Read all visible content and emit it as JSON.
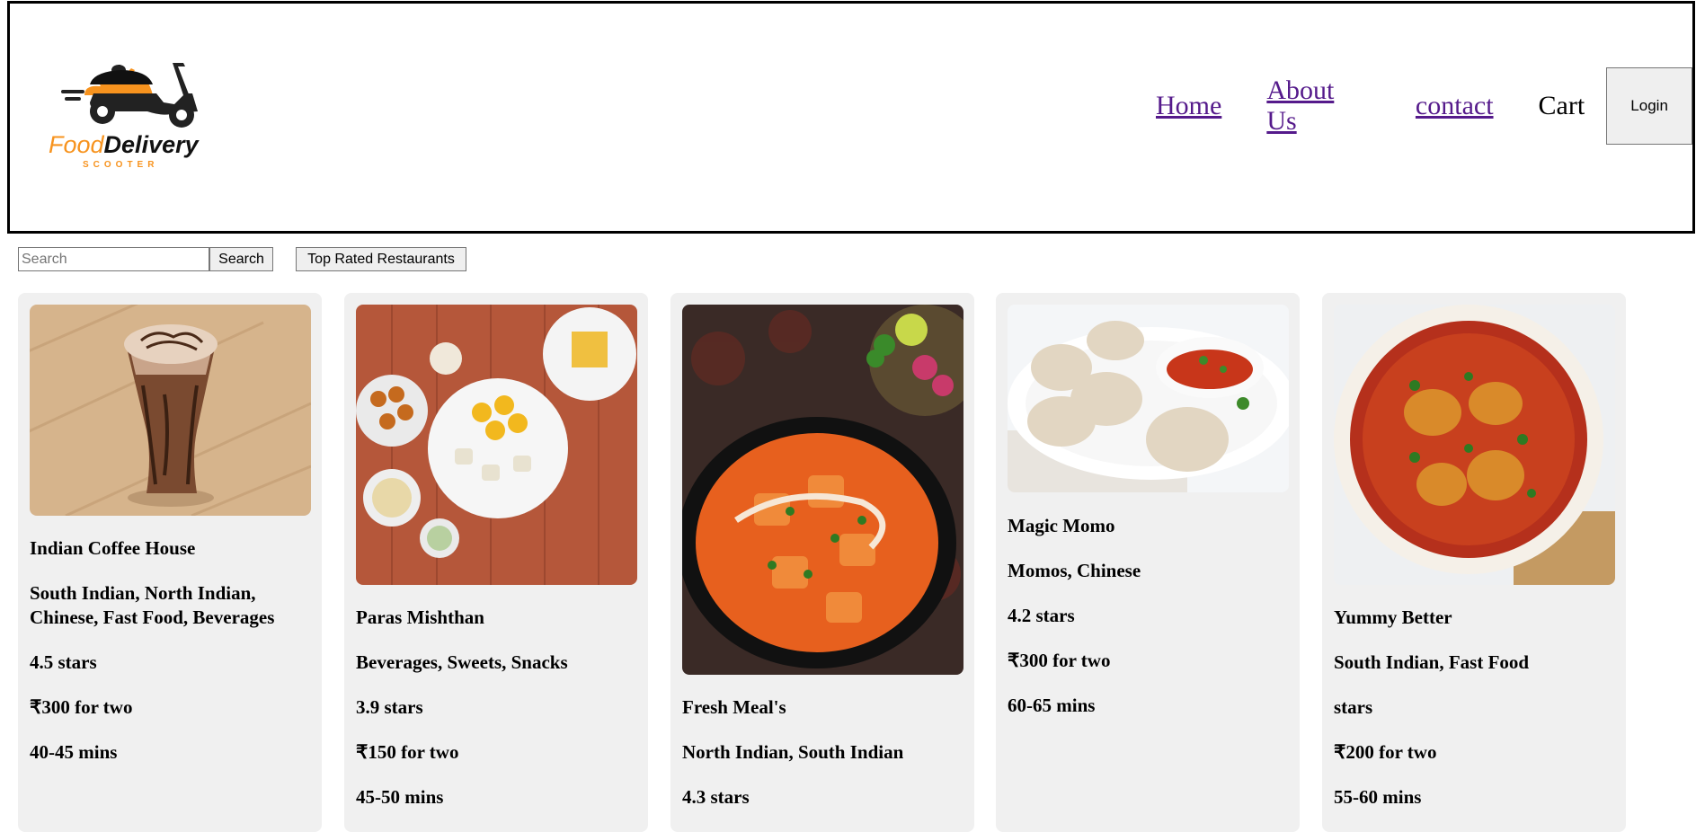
{
  "header": {
    "logo": {
      "brand_food": "Food",
      "brand_delivery": "Delivery",
      "brand_sub": "SCOOTER"
    },
    "nav": {
      "home": "Home",
      "about": "About Us",
      "contact": "contact",
      "cart": "Cart"
    },
    "login_label": "Login"
  },
  "toolbar": {
    "search_placeholder": "Search",
    "search_label": "Search",
    "top_rated_label": "Top Rated Restaurants"
  },
  "restaurants": [
    {
      "name": "Indian Coffee House",
      "cuisines": "South Indian, North Indian, Chinese, Fast Food, Beverages",
      "rating": "4.5 stars",
      "cost": "₹300 for two",
      "time": "40-45 mins",
      "image": "cold-coffee-glass"
    },
    {
      "name": "Paras Mishthan",
      "cuisines": "Beverages, Sweets, Snacks",
      "rating": "3.9 stars",
      "cost": "₹150 for two",
      "time": "45-50 mins",
      "image": "sweets-platter"
    },
    {
      "name": "Fresh Meal's",
      "cuisines": "North Indian, South Indian",
      "rating": "4.3 stars",
      "cost": "",
      "time": "",
      "image": "paneer-curry-bowl"
    },
    {
      "name": "Magic Momo",
      "cuisines": "Momos, Chinese",
      "rating": "4.2 stars",
      "cost": "₹300 for two",
      "time": "60-65 mins",
      "image": "momos-plate"
    },
    {
      "name": "Yummy Better",
      "cuisines": "South Indian, Fast Food",
      "rating": "stars",
      "cost": "₹200 for two",
      "time": "55-60 mins",
      "image": "curry-bowl"
    }
  ],
  "colors": {
    "link": "#551a8b",
    "card_bg": "#f0f0f0",
    "logo_orange": "#f7931e"
  }
}
